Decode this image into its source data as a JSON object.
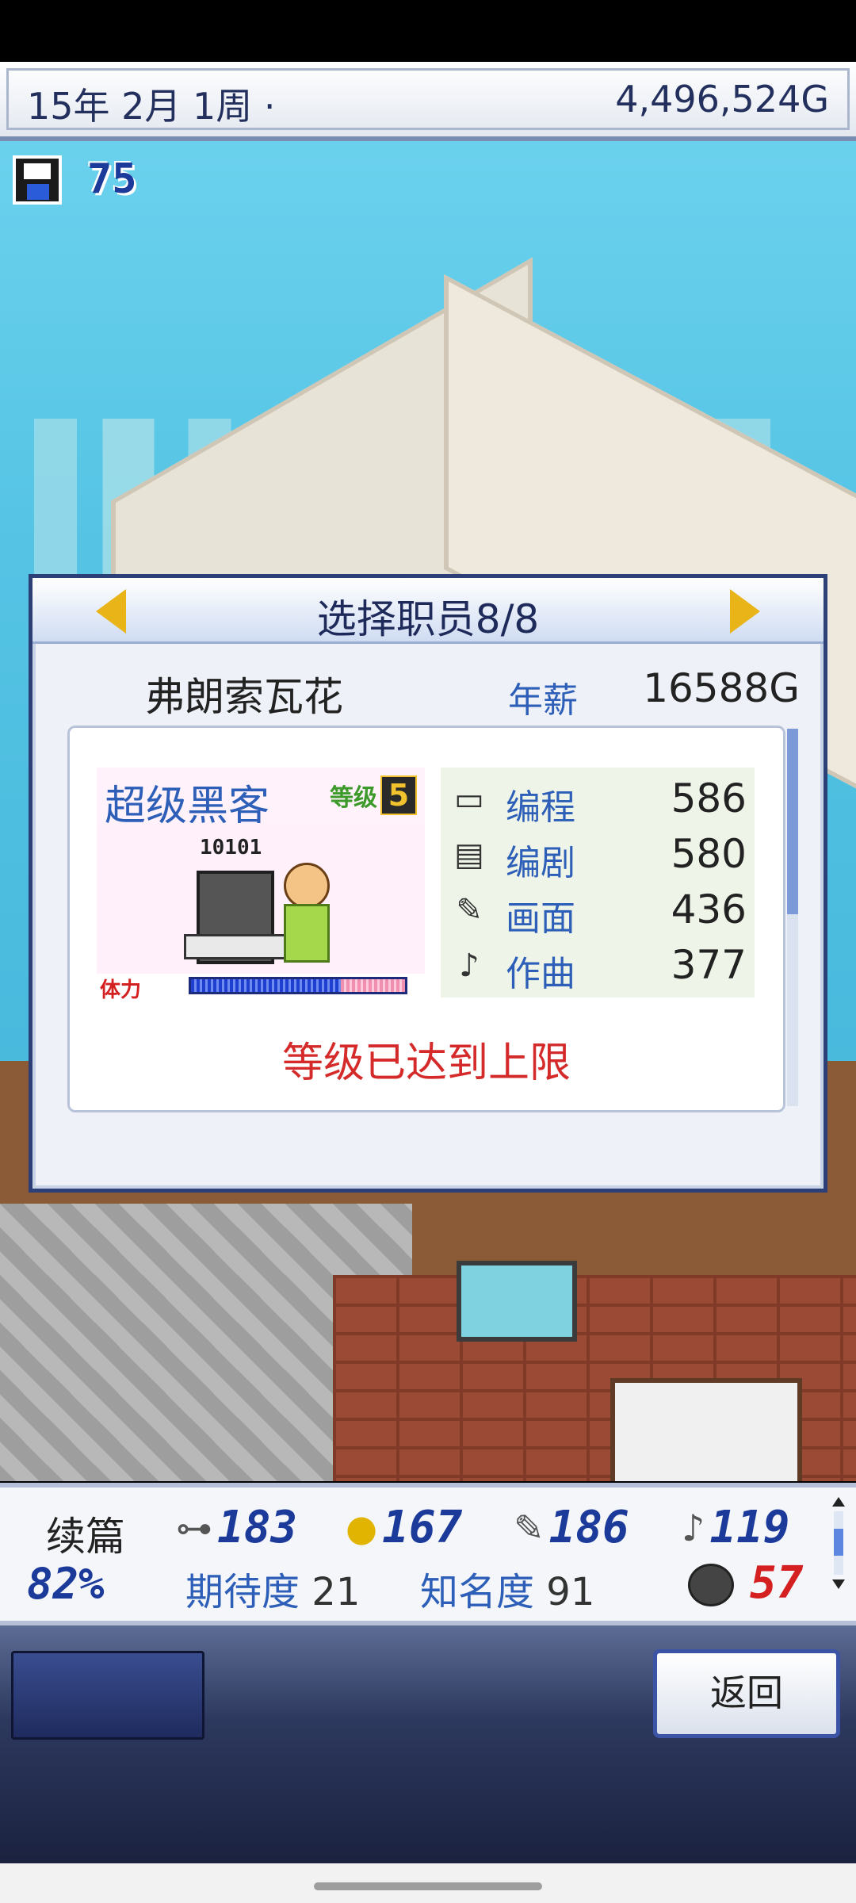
{
  "topbar": {
    "date": "15年 2月 1周 ·",
    "money": "4,496,524G"
  },
  "save": {
    "count": "75"
  },
  "dialog": {
    "title": "选择职员8/8",
    "employee_name": "弗朗索瓦花",
    "salary_label": "年薪",
    "salary_value": "16588G",
    "job": "超级黑客",
    "level_label": "等级",
    "level": "5",
    "portrait_text": "10101",
    "stamina_label": "体力",
    "stamina_fraction": 0.7,
    "stats": [
      {
        "icon": "computer-icon",
        "label": "编程",
        "value": "586"
      },
      {
        "icon": "book-icon",
        "label": "编剧",
        "value": "580"
      },
      {
        "icon": "paint-icon",
        "label": "画面",
        "value": "436"
      },
      {
        "icon": "trumpet-icon",
        "label": "作曲",
        "value": "377"
      }
    ],
    "status_message": "等级已达到上限"
  },
  "info": {
    "sequel_label": "续篇",
    "sequel_pct": "82%",
    "stats": [
      {
        "icon": "controller-icon",
        "value": "183"
      },
      {
        "icon": "coin-icon",
        "value": "167"
      },
      {
        "icon": "paint-icon",
        "value": "186"
      },
      {
        "icon": "trumpet-icon",
        "value": "119"
      }
    ],
    "expectation_label": "期待度",
    "expectation_value": "21",
    "fame_label": "知名度",
    "fame_value": "91",
    "bugs_value": "57"
  },
  "bottombar": {
    "back_label": "返回"
  },
  "colors": {
    "accent": "#2d5fb8",
    "warning": "#d42a2a",
    "frame": "#2d3f77"
  }
}
